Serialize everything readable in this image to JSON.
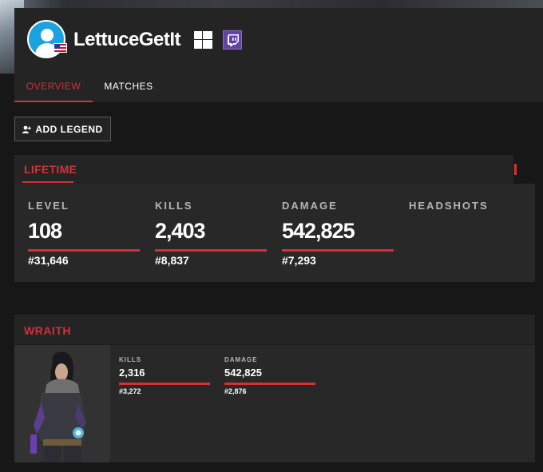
{
  "profile": {
    "username": "LettuceGetIt",
    "platform_icon": "windows-icon",
    "linked_icon": "twitch-icon",
    "country_icon": "us-flag-icon",
    "colors": {
      "accent": "#d23138",
      "twitch": "#6441a5",
      "avatar": "#1ba3e0"
    }
  },
  "tabs": [
    {
      "label": "OVERVIEW",
      "active": true
    },
    {
      "label": "MATCHES",
      "active": false
    }
  ],
  "actions": {
    "add_legend_label": "ADD LEGEND"
  },
  "lifetime": {
    "title": "LIFETIME",
    "stats": [
      {
        "label": "LEVEL",
        "value": "108",
        "rank": "#31,646",
        "percentile_fill": 1.0
      },
      {
        "label": "KILLS",
        "value": "2,403",
        "rank": "#8,837",
        "percentile_fill": 1.0
      },
      {
        "label": "DAMAGE",
        "value": "542,825",
        "rank": "#7,293",
        "percentile_fill": 1.0
      },
      {
        "label": "HEADSHOTS",
        "value": "",
        "rank": ""
      }
    ]
  },
  "legend": {
    "name": "WRAITH",
    "stats": [
      {
        "label": "KILLS",
        "value": "2,316",
        "rank": "#3,272",
        "percentile_fill": 1.0
      },
      {
        "label": "DAMAGE",
        "value": "542,825",
        "rank": "#2,876",
        "percentile_fill": 1.0
      }
    ]
  }
}
